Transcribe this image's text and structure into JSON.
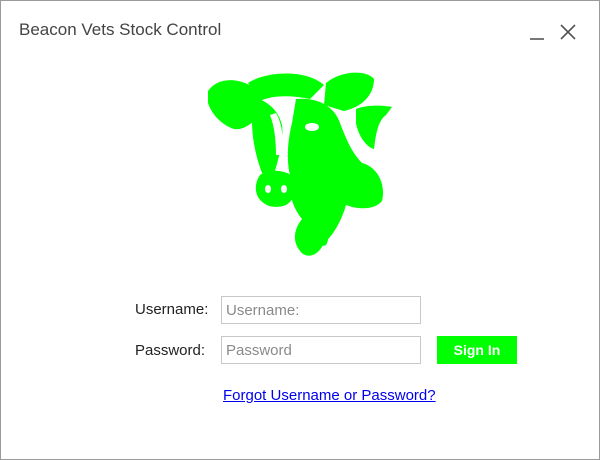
{
  "window": {
    "title": "Beacon Vets Stock Control"
  },
  "brand": {
    "logo_icon": "cow-head-logo-icon",
    "logo_color": "#00ff00"
  },
  "form": {
    "username_label": "Username:",
    "username_placeholder": "Username:",
    "username_value": "",
    "password_label": "Password:",
    "password_placeholder": "Password",
    "password_value": "",
    "signin_label": "Sign In",
    "signin_color": "#00ff00",
    "forgot_link": " Forgot Username or Password?"
  }
}
